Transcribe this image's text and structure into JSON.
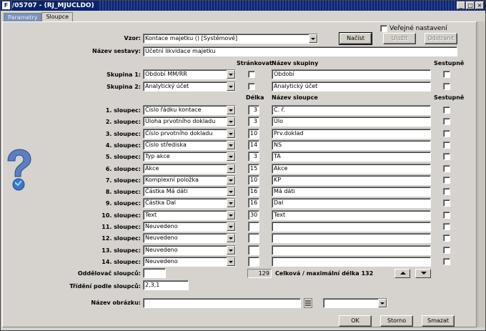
{
  "window": {
    "title": "/05707 - (RJ_MJUCLDO)",
    "app_icon": "forms-icon"
  },
  "tabs": [
    "Parametry",
    "Sloupce"
  ],
  "top": {
    "public_label": "Veřejné nastavení",
    "vzor_label": "Vzor:",
    "vzor_value": "Kontace majetku  ()  [Systémové]",
    "nacist": "Načíst",
    "ulozit": "Uložit",
    "odstranit": "Odstranit",
    "nazev_sestavy_label": "Název sestavy:",
    "nazev_sestavy_value": "Účetní likvidace majetku"
  },
  "groups": {
    "hdr_strankovat": "Stránkovat",
    "hdr_nazev_skupiny": "Název skupiny",
    "hdr_sestupne": "Sestupně",
    "rows": [
      {
        "label": "Skupina 1:",
        "field": "Období MM/RR",
        "name": "Období"
      },
      {
        "label": "Skupina 2:",
        "field": "Analytický účet",
        "name": "Analytický účet"
      }
    ]
  },
  "columns": {
    "hdr_delka": "Délka",
    "hdr_nazev_sloupce": "Název sloupce",
    "hdr_sestupne": "Sestupně",
    "rows": [
      {
        "label": "1. sloupec:",
        "field": "Číslo řádku kontace",
        "len": "3",
        "name": "Č. ř."
      },
      {
        "label": "2. sloupec:",
        "field": "Úloha prvotního dokladu",
        "len": "3",
        "name": "Úlo"
      },
      {
        "label": "3. sloupec:",
        "field": "Číslo prvotního dokladu",
        "len": "10",
        "name": "Prv.doklad"
      },
      {
        "label": "4. sloupec:",
        "field": "Číslo střediska",
        "len": "14",
        "name": "NS"
      },
      {
        "label": "5. sloupec:",
        "field": "Typ akce",
        "len": "3",
        "name": "TA"
      },
      {
        "label": "6. sloupec:",
        "field": "Akce",
        "len": "15",
        "name": "Akce"
      },
      {
        "label": "7. sloupec:",
        "field": "Komplexní položka",
        "len": "10",
        "name": "KP"
      },
      {
        "label": "8. sloupec:",
        "field": "Částka Má dáti",
        "len": "16",
        "name": "Má dáti"
      },
      {
        "label": "9. sloupec:",
        "field": "Částka Dal",
        "len": "16",
        "name": "Dal"
      },
      {
        "label": "10. sloupec:",
        "field": "Text",
        "len": "30",
        "name": "Text"
      },
      {
        "label": "11. sloupec:",
        "field": "Neuvedeno",
        "len": "",
        "name": ""
      },
      {
        "label": "12. sloupec:",
        "field": "Neuvedeno",
        "len": "",
        "name": ""
      },
      {
        "label": "13. sloupec:",
        "field": "Neuvedeno",
        "len": "",
        "name": ""
      },
      {
        "label": "14. sloupec:",
        "field": "Neuvedeno",
        "len": "",
        "name": ""
      }
    ]
  },
  "bottom": {
    "oddelovac_label": "Oddělovač sloupců:",
    "oddelovac_value": "",
    "total_value": "129",
    "total_label": "Celková / maximální délka 132",
    "trideni_label": "Třídění podle sloupců:",
    "trideni_value": "2,3,1",
    "obrazek_label": "Název obrázku:",
    "obrazek_value": "",
    "obrazek_combo": ""
  },
  "buttons": {
    "ok": "OK",
    "storno": "Storno",
    "smazat": "Smazat"
  },
  "icons": {
    "help": "help-question-icon"
  },
  "colors": {
    "titlebar": "#0a246a",
    "tab_inactive": "#7a93b8"
  }
}
